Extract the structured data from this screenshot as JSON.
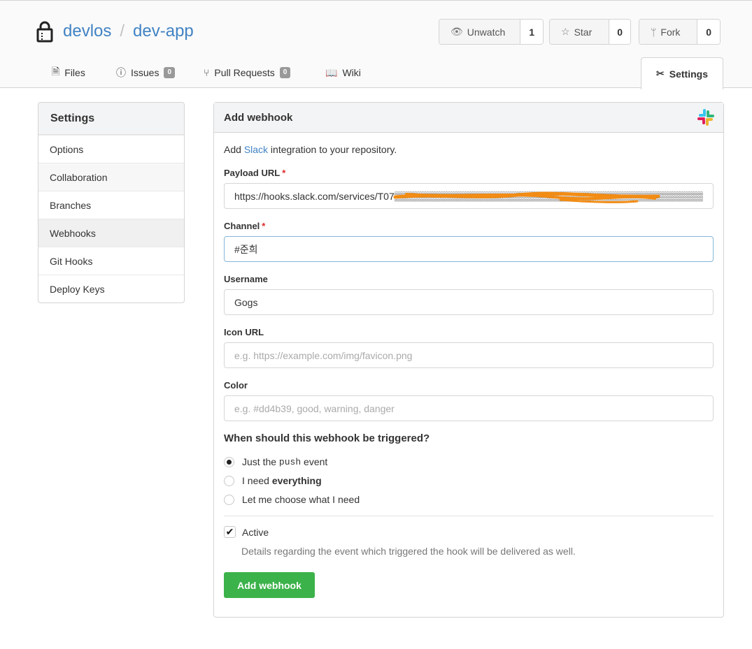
{
  "repo": {
    "owner": "devlos",
    "separator": "/",
    "name": "dev-app"
  },
  "actions": {
    "watch": {
      "label": "Unwatch",
      "count": "1",
      "icon": "eye-icon"
    },
    "star": {
      "label": "Star",
      "count": "0",
      "icon": "star-icon"
    },
    "fork": {
      "label": "Fork",
      "count": "0",
      "icon": "fork-icon"
    }
  },
  "tabs": [
    {
      "label": "Files",
      "icon": "file-icon"
    },
    {
      "label": "Issues",
      "badge": "0",
      "icon": "issue-icon"
    },
    {
      "label": "Pull Requests",
      "badge": "0",
      "icon": "pull-request-icon"
    },
    {
      "label": "Wiki",
      "icon": "book-icon"
    },
    {
      "label": "Settings",
      "icon": "tools-icon",
      "active": true
    }
  ],
  "sidebar": {
    "title": "Settings",
    "items": [
      "Options",
      "Collaboration",
      "Branches",
      "Webhooks",
      "Git Hooks",
      "Deploy Keys"
    ],
    "selected": "Webhooks"
  },
  "form": {
    "title": "Add webhook",
    "desc_prefix": "Add ",
    "desc_link": "Slack",
    "desc_suffix": " integration to your repository.",
    "payload_label": "Payload URL",
    "payload_value": "https://hooks.slack.com/services/T07▒▒▒▒▒▒▒▒▒▒▒▒▒▒▒▒▒▒▒▒▒▒▒▒▒▒▒▒▒▒▒▒▒▒▒▒▒▒▒▒▒▒▒▒▒NSK",
    "channel_label": "Channel",
    "channel_value": "#준희",
    "username_label": "Username",
    "username_value": "Gogs",
    "icon_label": "Icon URL",
    "icon_placeholder": "e.g. https://example.com/img/favicon.png",
    "color_label": "Color",
    "color_placeholder": "e.g. #dd4b39, good, warning, danger",
    "trigger_title": "When should this webhook be triggered?",
    "opt1_prefix": "Just the ",
    "opt1_code": "push",
    "opt1_suffix": " event",
    "opt2_prefix": "I need ",
    "opt2_bold": "everything",
    "opt3": "Let me choose what I need",
    "selected_option": 1,
    "active_label": "Active",
    "active_checked": true,
    "active_help": "Details regarding the event which triggered the hook will be delivered as well.",
    "submit_label": "Add webhook"
  },
  "colors": {
    "link": "#4183c4",
    "submit": "#3bb24a",
    "required": "#db2828",
    "redaction": "#f28c14"
  }
}
